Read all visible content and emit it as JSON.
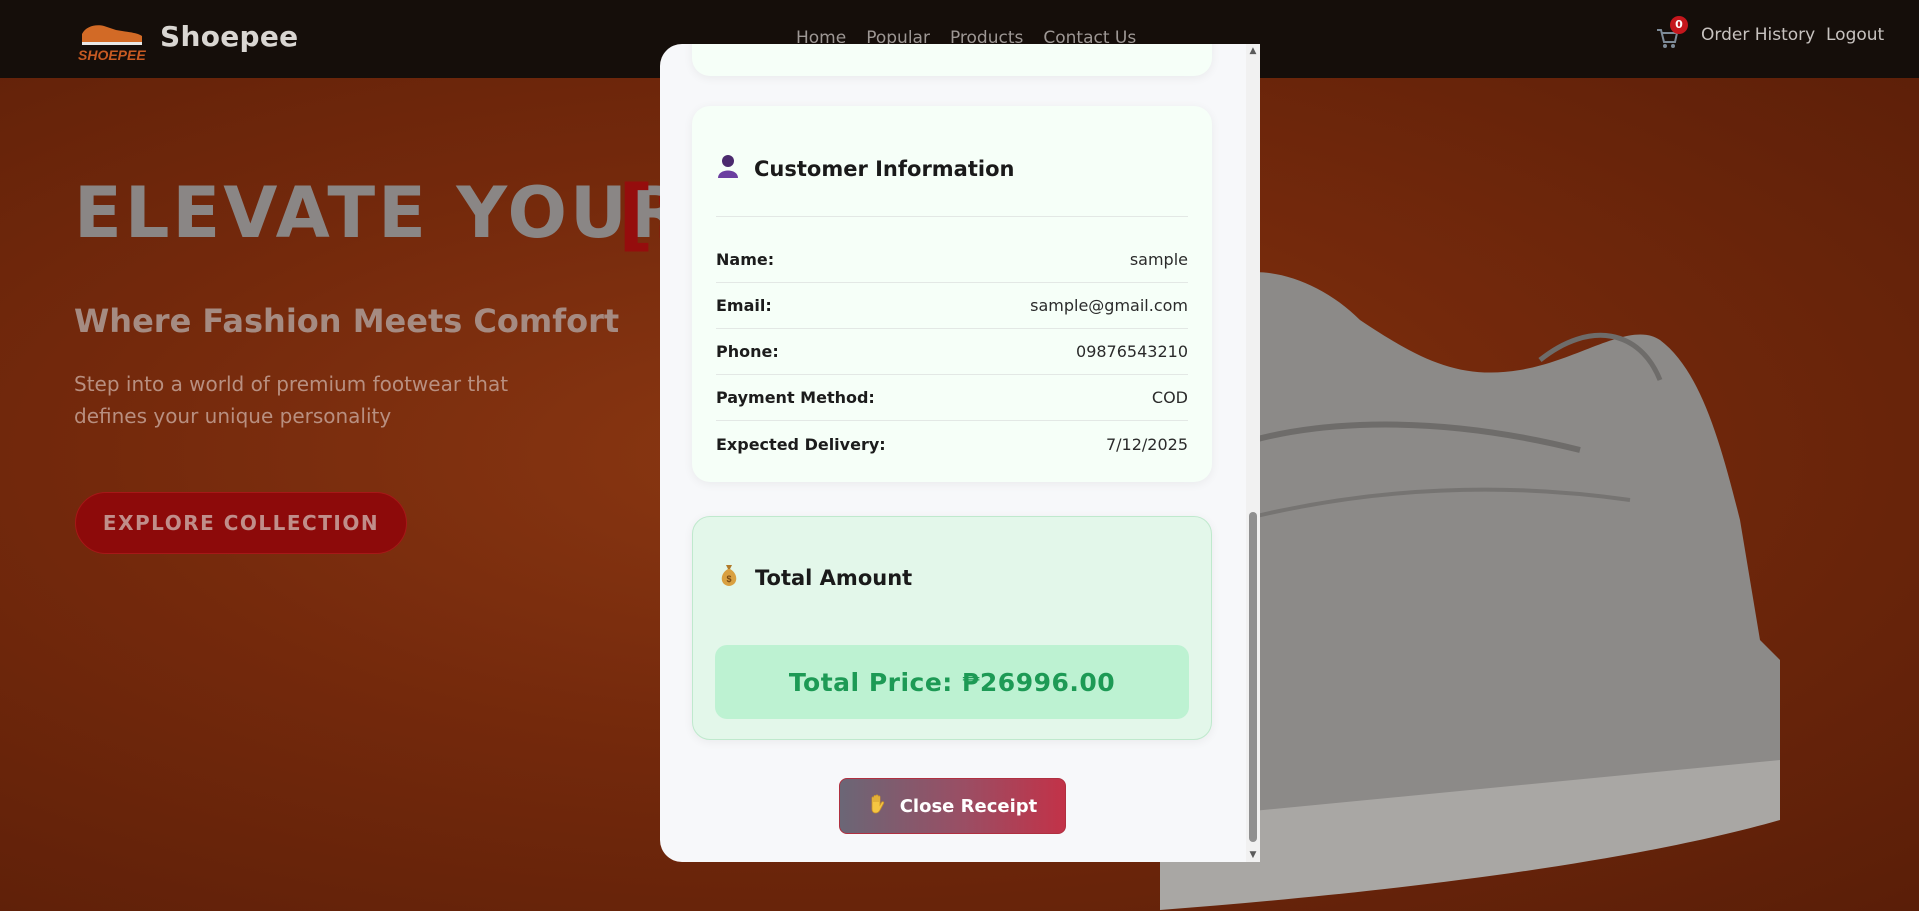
{
  "app": {
    "brand": "Shoepee",
    "logo_text": "SHOEPEE"
  },
  "nav": {
    "links": [
      "Home",
      "Popular",
      "Products",
      "Contact Us"
    ],
    "cart_count": "0",
    "order_history": "Order History",
    "logout": "Logout"
  },
  "hero": {
    "title": "ELEVATE YOUR",
    "bracket": "[S",
    "subtitle": "Where Fashion Meets Comfort",
    "description": "Step into a world of premium footwear that defines your unique personality",
    "cta": "EXPLORE COLLECTION"
  },
  "receipt": {
    "customer": {
      "title": "Customer Information",
      "icon": "person-icon",
      "rows": [
        {
          "label": "Name:",
          "value": "sample"
        },
        {
          "label": "Email:",
          "value": "sample@gmail.com"
        },
        {
          "label": "Phone:",
          "value": "09876543210"
        },
        {
          "label": "Payment Method:",
          "value": "COD"
        },
        {
          "label": "Expected Delivery:",
          "value": "7/12/2025"
        }
      ]
    },
    "total": {
      "title": "Total Amount",
      "icon": "money-bag-icon",
      "price_text": "Total Price: ₱26996.00"
    },
    "close_label": "Close Receipt",
    "close_icon": "raised-hand-icon"
  },
  "colors": {
    "accent_green": "#1d9a55",
    "brand_red": "#8d0a0a",
    "close_gradient_end": "#c23248"
  }
}
